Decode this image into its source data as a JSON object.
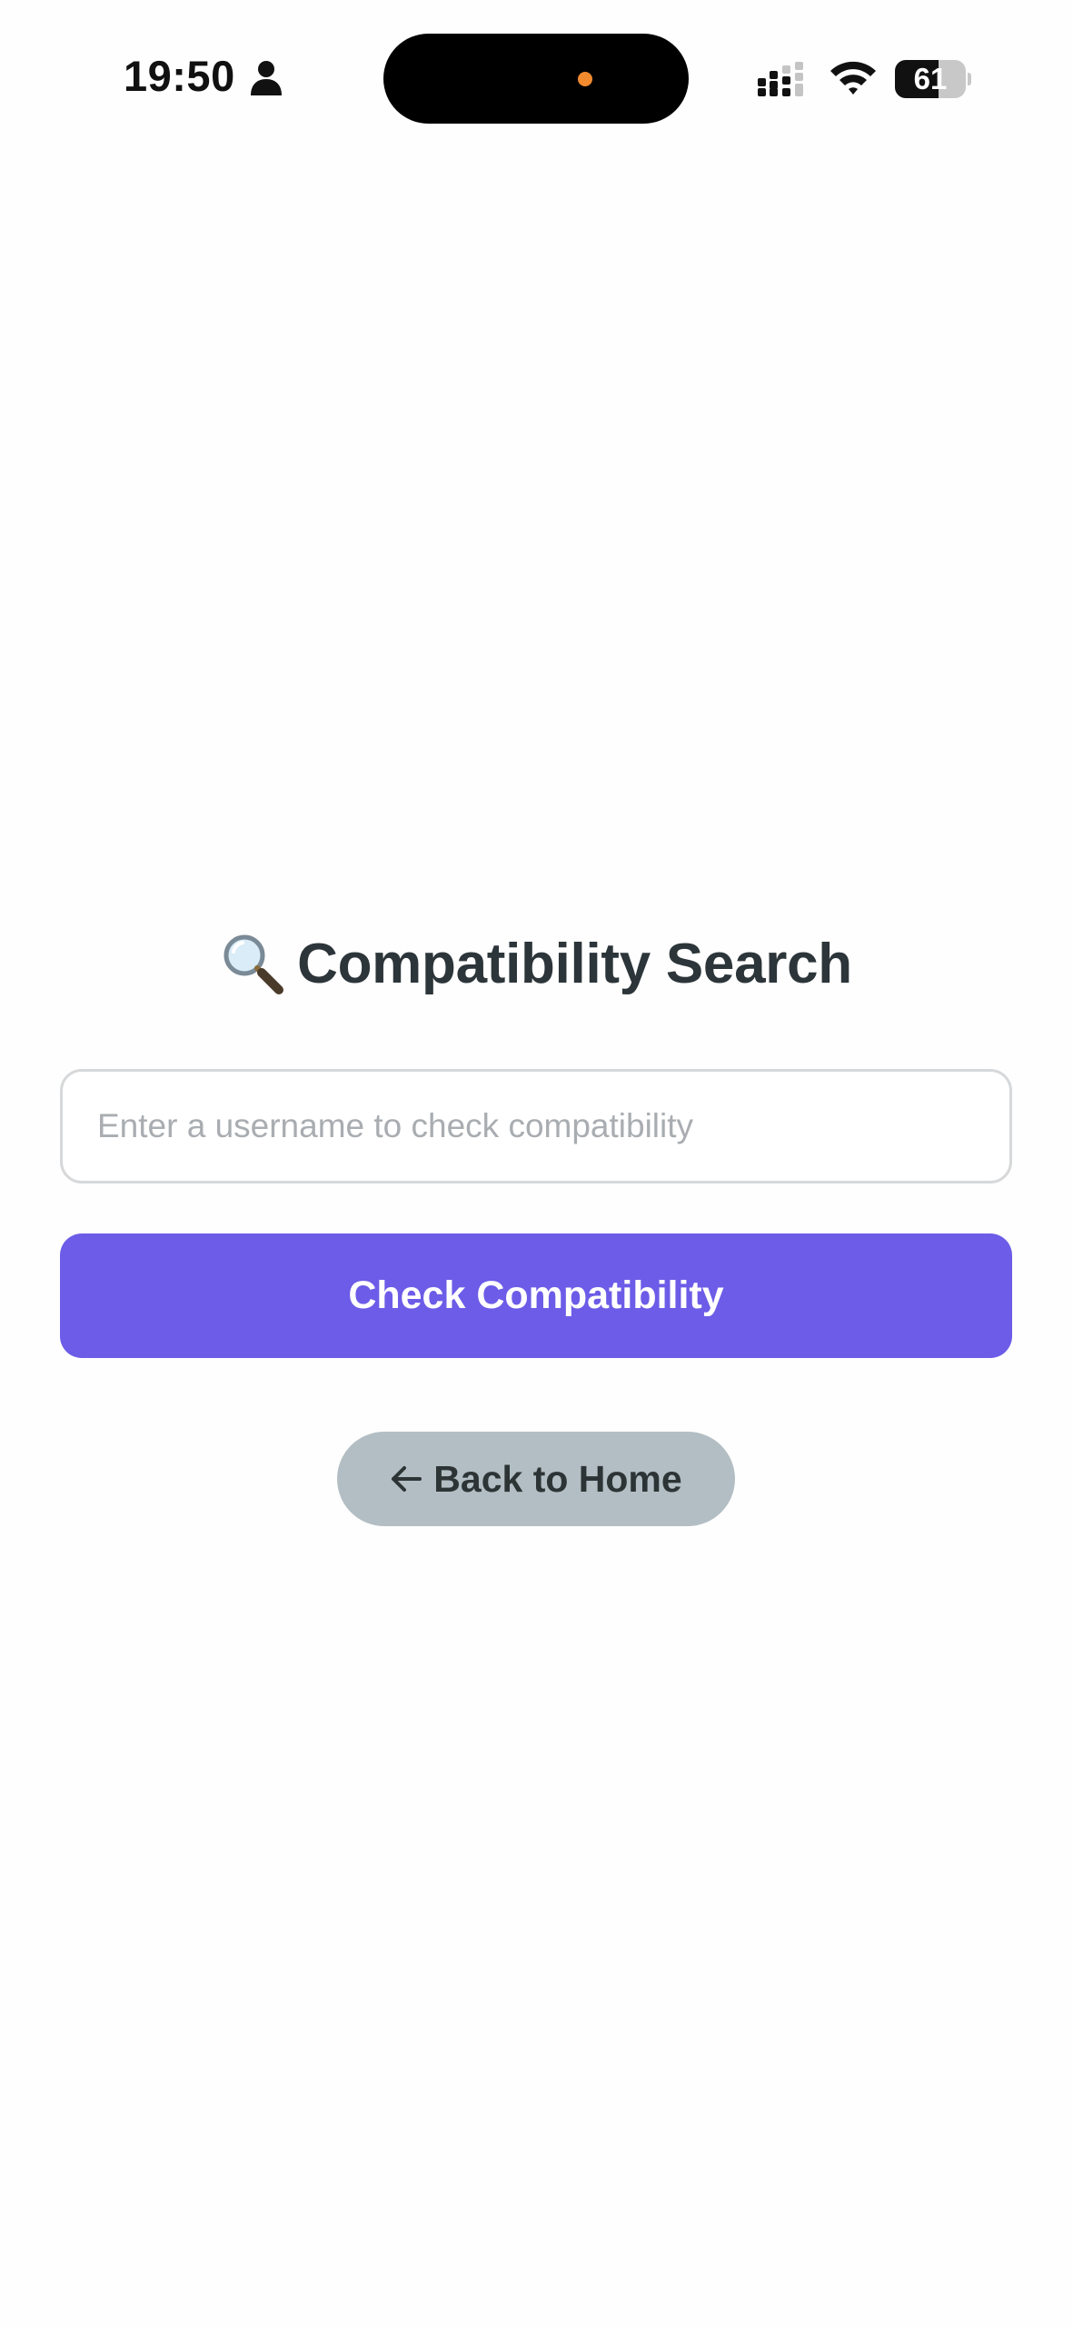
{
  "status_bar": {
    "time": "19:50",
    "battery_level": "61",
    "battery_fraction": 0.61,
    "icons": [
      "person-icon",
      "signal-icon",
      "wifi-icon",
      "battery-icon"
    ],
    "camera_dot_color": "#f28a2e"
  },
  "main": {
    "title_icon": "magnifying-glass-icon",
    "title": "Compatibility Search",
    "username_input": {
      "value": "",
      "placeholder": "Enter a username to check compatibility"
    },
    "check_button_label": "Check Compatibility",
    "back_button_label": "Back to Home",
    "back_button_icon": "left-arrow-icon"
  },
  "colors": {
    "accent": "#6c5ce7",
    "title_text": "#2c3539",
    "secondary_button_bg": "#b2bec3",
    "secondary_button_text": "#2d3436",
    "input_border": "#d6d8da",
    "placeholder": "#a9adb1"
  }
}
